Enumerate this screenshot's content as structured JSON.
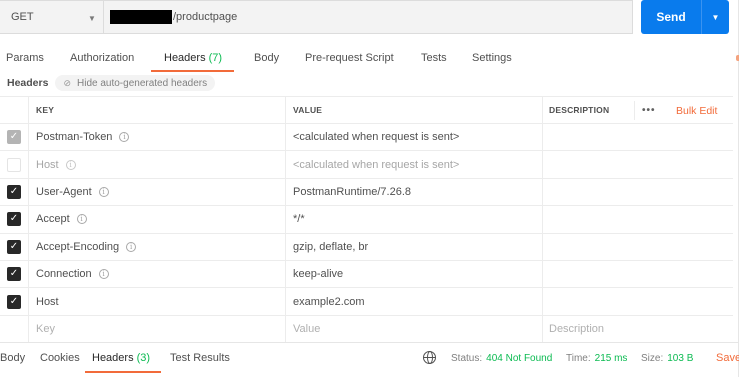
{
  "request": {
    "method": "GET",
    "url_suffix": "/productpage",
    "send_label": "Send"
  },
  "tabs": [
    {
      "label": "Params",
      "count": ""
    },
    {
      "label": "Authorization",
      "count": ""
    },
    {
      "label": "Headers",
      "count": "(7)"
    },
    {
      "label": "Body",
      "count": ""
    },
    {
      "label": "Pre-request Script",
      "count": ""
    },
    {
      "label": "Tests",
      "count": ""
    },
    {
      "label": "Settings",
      "count": ""
    }
  ],
  "headers_section": {
    "label": "Headers",
    "hide_button": "Hide auto-generated headers"
  },
  "table": {
    "columns": {
      "key": "KEY",
      "value": "VALUE",
      "description": "DESCRIPTION",
      "more": "•••",
      "bulk_edit": "Bulk Edit"
    },
    "rows": [
      {
        "checked": "disabled",
        "key": "Postman-Token",
        "value": "<calculated when request is sent>",
        "info": true,
        "muted": false
      },
      {
        "checked": "empty",
        "key": "Host",
        "value": "<calculated when request is sent>",
        "info": true,
        "muted": true
      },
      {
        "checked": "on",
        "key": "User-Agent",
        "value": "PostmanRuntime/7.26.8",
        "info": true,
        "muted": false
      },
      {
        "checked": "on",
        "key": "Accept",
        "value": "*/*",
        "info": true,
        "muted": false
      },
      {
        "checked": "on",
        "key": "Accept-Encoding",
        "value": "gzip, deflate, br",
        "info": true,
        "muted": false
      },
      {
        "checked": "on",
        "key": "Connection",
        "value": "keep-alive",
        "info": true,
        "muted": false
      },
      {
        "checked": "on",
        "key": "Host",
        "value": "example2.com",
        "info": false,
        "muted": false
      }
    ],
    "placeholder": {
      "key": "Key",
      "value": "Value",
      "description": "Description"
    }
  },
  "response": {
    "tabs": [
      {
        "label": "Body",
        "count": ""
      },
      {
        "label": "Cookies",
        "count": ""
      },
      {
        "label": "Headers",
        "count": "(3)"
      },
      {
        "label": "Test Results",
        "count": ""
      }
    ],
    "status_label": "Status:",
    "status_value": "404 Not Found",
    "time_label": "Time:",
    "time_value": "215 ms",
    "size_label": "Size:",
    "size_value": "103 B",
    "save_label": "Save"
  },
  "colors": {
    "accent": "#f26b3a",
    "send": "#097bed",
    "success": "#0cbb52"
  },
  "icons": {
    "method_caret": "caret-down-icon",
    "hide": "eye-slash-icon",
    "info": "info-icon",
    "check": "check-icon",
    "globe": "globe-icon"
  }
}
